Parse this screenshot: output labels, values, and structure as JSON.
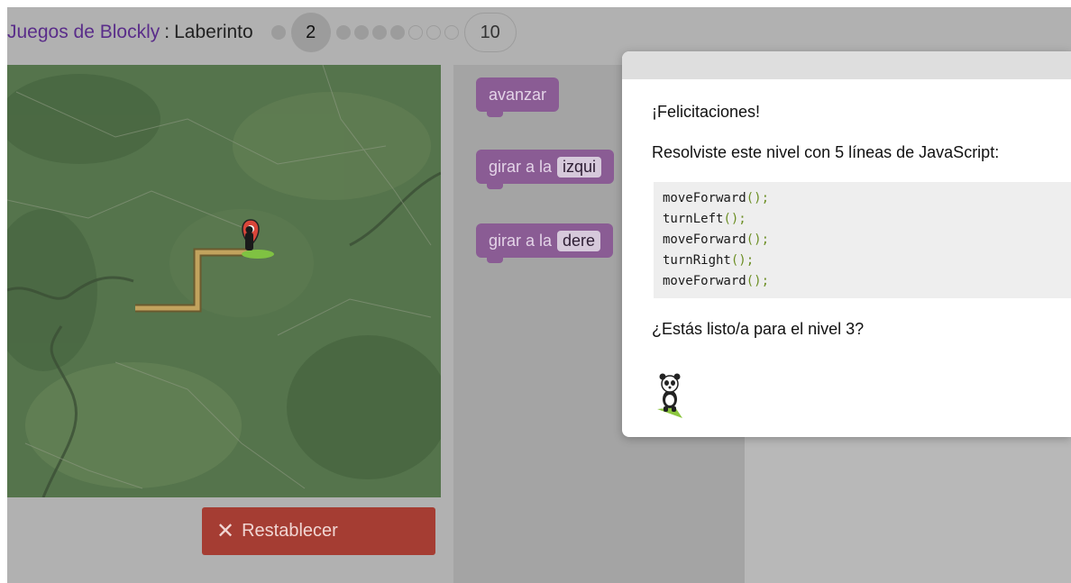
{
  "header": {
    "app_title": "Juegos de Blockly",
    "separator": ":",
    "game_title": "Laberinto",
    "current_level": "2",
    "last_level": "10"
  },
  "toolbox": {
    "blocks": [
      {
        "label": "avanzar"
      },
      {
        "label": "girar a la",
        "field": "izqui"
      },
      {
        "label": "girar a la",
        "field": "dere"
      }
    ]
  },
  "reset_button": {
    "label": "Restablecer",
    "icon": "close-icon"
  },
  "dialog": {
    "congrats": "¡Felicitaciones!",
    "solved_text": "Resolviste este nivel con 5 líneas de JavaScript:",
    "code_lines": [
      {
        "name": "moveForward",
        "parens": "();"
      },
      {
        "name": "turnLeft",
        "parens": "();"
      },
      {
        "name": "moveForward",
        "parens": "();"
      },
      {
        "name": "turnRight",
        "parens": "();"
      },
      {
        "name": "moveForward",
        "parens": "();"
      }
    ],
    "next_prompt": "¿Estás listo/a para el nivel 3?",
    "mascot_icon": "panda-icon"
  },
  "colors": {
    "title_purple": "#5a2d8a",
    "block_purple": "#8a5c94",
    "reset_red": "#a53d33",
    "code_paren": "#6b8e23"
  }
}
